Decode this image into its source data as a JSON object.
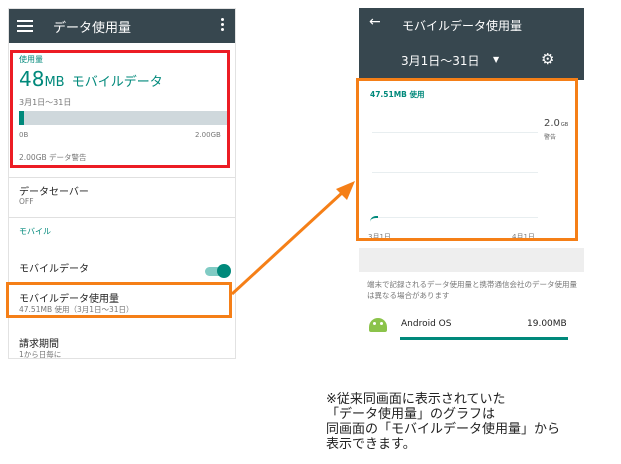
{
  "screen1": {
    "title": "データ使用量",
    "usage_label": "使用量",
    "usage_number": "48",
    "usage_unit": "MB",
    "usage_desc": "モバイルデータ",
    "date_range": "3月1日〜31日",
    "bar_min": "0B",
    "bar_max": "2.00GB",
    "bar_fraction": 0.024,
    "warning": "2.00GB データ警告",
    "data_saver_title": "データセーバー",
    "data_saver_status": "OFF",
    "mobile_section": "モバイル",
    "mobile_data_label": "モバイルデータ",
    "mobile_data_enabled": true,
    "mobile_usage_title": "モバイルデータ使用量",
    "mobile_usage_sub": "47.51MB 使用（3月1日〜31日）",
    "billing_title": "請求期間",
    "billing_sub": "1から日毎に"
  },
  "screen2": {
    "title": "モバイルデータ使用量",
    "date_range": "3月1日〜31日",
    "chart_usage": "47.51MB 使用",
    "limit_value": "2.0",
    "limit_unit": "GB",
    "limit_label": "警告",
    "x_start": "3月1日",
    "x_end": "4月1日",
    "info_text": "端末で記録されるデータ使用量と携帯通信会社のデータ使用量は異なる場合があります",
    "app_name": "Android OS",
    "app_usage": "19.00MB"
  },
  "note": {
    "line1": "※従来同画面に表示されていた",
    "line2": "「データ使用量」のグラフは",
    "line3": "同画面の「モバイルデータ使用量」から",
    "line4": "表示できます。"
  },
  "colors": {
    "accent": "#00897b",
    "toolbar": "#37474f",
    "highlight_red": "#ec1c24",
    "highlight_orange": "#f57f17"
  }
}
